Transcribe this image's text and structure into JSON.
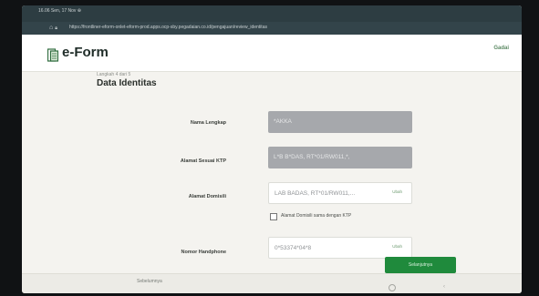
{
  "statusbar": {
    "time": "16.06 Sen, 17 Nov  ⊕"
  },
  "browser": {
    "url": "https://frontliner-eform-onlet-eform-prod.apps.ocp-sby.pegadaian.co.id/pengajuan/review_identitas"
  },
  "header": {
    "title": "e-Form",
    "link": "Gadai"
  },
  "form": {
    "step": "Langkah 4 dari 5",
    "title": "Data Identitas",
    "fields": [
      {
        "label": "Nama Lengkap",
        "value": "*AKKA",
        "tag": ""
      },
      {
        "label": "Alamat Sesuai KTP",
        "value": "L*B B*DAS, RT*01/RW011,*,",
        "tag": ""
      },
      {
        "label": "Alamat Domisili",
        "value": "LAB BADAS, RT*01/RW011,...",
        "tag": "Ubah"
      },
      {
        "label": "Nomor Handphone",
        "value": "0*53374*04*8",
        "tag": "Ubah"
      }
    ],
    "checkbox_label": "Alamat Domisili sama dengan KTP",
    "prev_label": "Sebelumnya",
    "next_label": "Selanjutnya"
  },
  "colors": {
    "primary": "#1f8a3c",
    "readonly_field": "#a6a8ac",
    "statusbar": "#2d3d42"
  },
  "icons": [
    "document-logo-icon",
    "home-icon",
    "lock-icon",
    "back-icon"
  ]
}
